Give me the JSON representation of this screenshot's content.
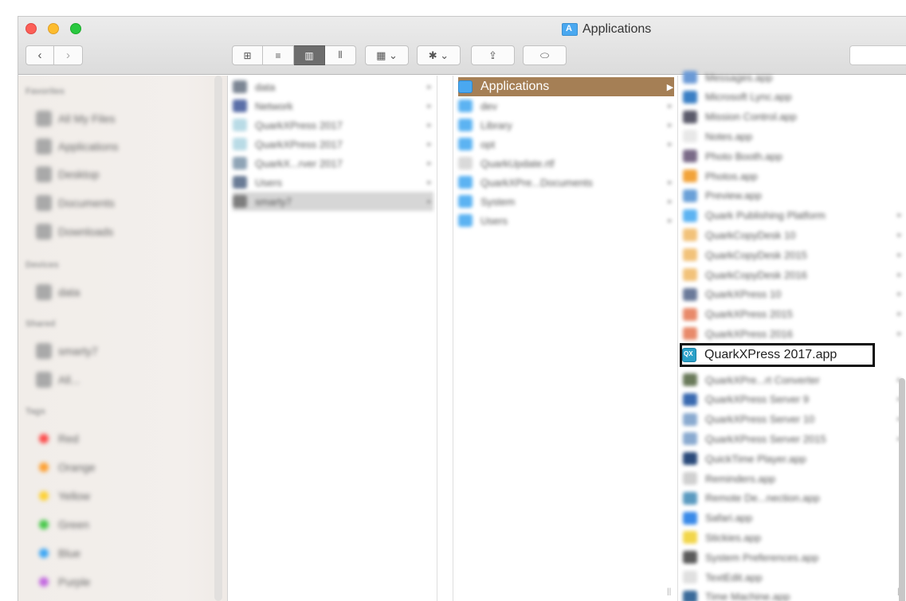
{
  "window": {
    "title": "Applications"
  },
  "toolbar": {
    "back_glyph": "‹",
    "forward_glyph": "›",
    "view_icons": [
      "⊞",
      "≡",
      "▥",
      "⫴"
    ],
    "arrange_glyph": "▦ ⌄",
    "action_glyph": "✱ ⌄",
    "share_glyph": "⇪",
    "tag_glyph": "⬭"
  },
  "sidebar": {
    "sections": [
      {
        "heading": "Favorites",
        "items": [
          "All My Files",
          "Applications",
          "Desktop",
          "Documents",
          "Downloads"
        ]
      },
      {
        "heading": "Devices",
        "items": [
          "data"
        ]
      },
      {
        "heading": "Shared",
        "items": [
          "smarty7",
          "All..."
        ]
      },
      {
        "heading": "Tags",
        "items": [
          "Red",
          "Orange",
          "Yellow",
          "Green",
          "Blue",
          "Purple"
        ]
      }
    ],
    "tag_colors": [
      "#fc4d4d",
      "#fda033",
      "#fdd134",
      "#48c84b",
      "#3ea7f4",
      "#c36ae0"
    ]
  },
  "column1": {
    "items": [
      "data",
      "Network",
      "QuarkXPress 2017",
      "QuarkXPress 2017",
      "QuarkX...rver 2017",
      "Users",
      "smarty7"
    ]
  },
  "column2": {
    "selected": "Applications",
    "items": [
      "dev",
      "Library",
      "opt",
      "QuarkUpdate.rtf",
      "QuarkXPre...Documents",
      "System",
      "Users"
    ]
  },
  "column3": {
    "items_before": [
      "Messages.app",
      "Microsoft Lync.app",
      "Mission Control.app",
      "Notes.app",
      "Photo Booth.app",
      "Photos.app",
      "Preview.app",
      "Quark Publishing Platform",
      "QuarkCopyDesk 10",
      "QuarkCopyDesk 2015",
      "QuarkCopyDesk 2016",
      "QuarkXPress 10",
      "QuarkXPress 2015",
      "QuarkXPress 2016"
    ],
    "highlighted": "QuarkXPress 2017.app",
    "items_after": [
      "QuarkXPre...rt Converter",
      "QuarkXPress Server 9",
      "QuarkXPress Server 10",
      "QuarkXPress Server 2015",
      "QuickTime Player.app",
      "Reminders.app",
      "Remote De...nection.app",
      "Safari.app",
      "Stickies.app",
      "System Preferences.app",
      "TextEdit.app",
      "Time Machine.app"
    ]
  }
}
